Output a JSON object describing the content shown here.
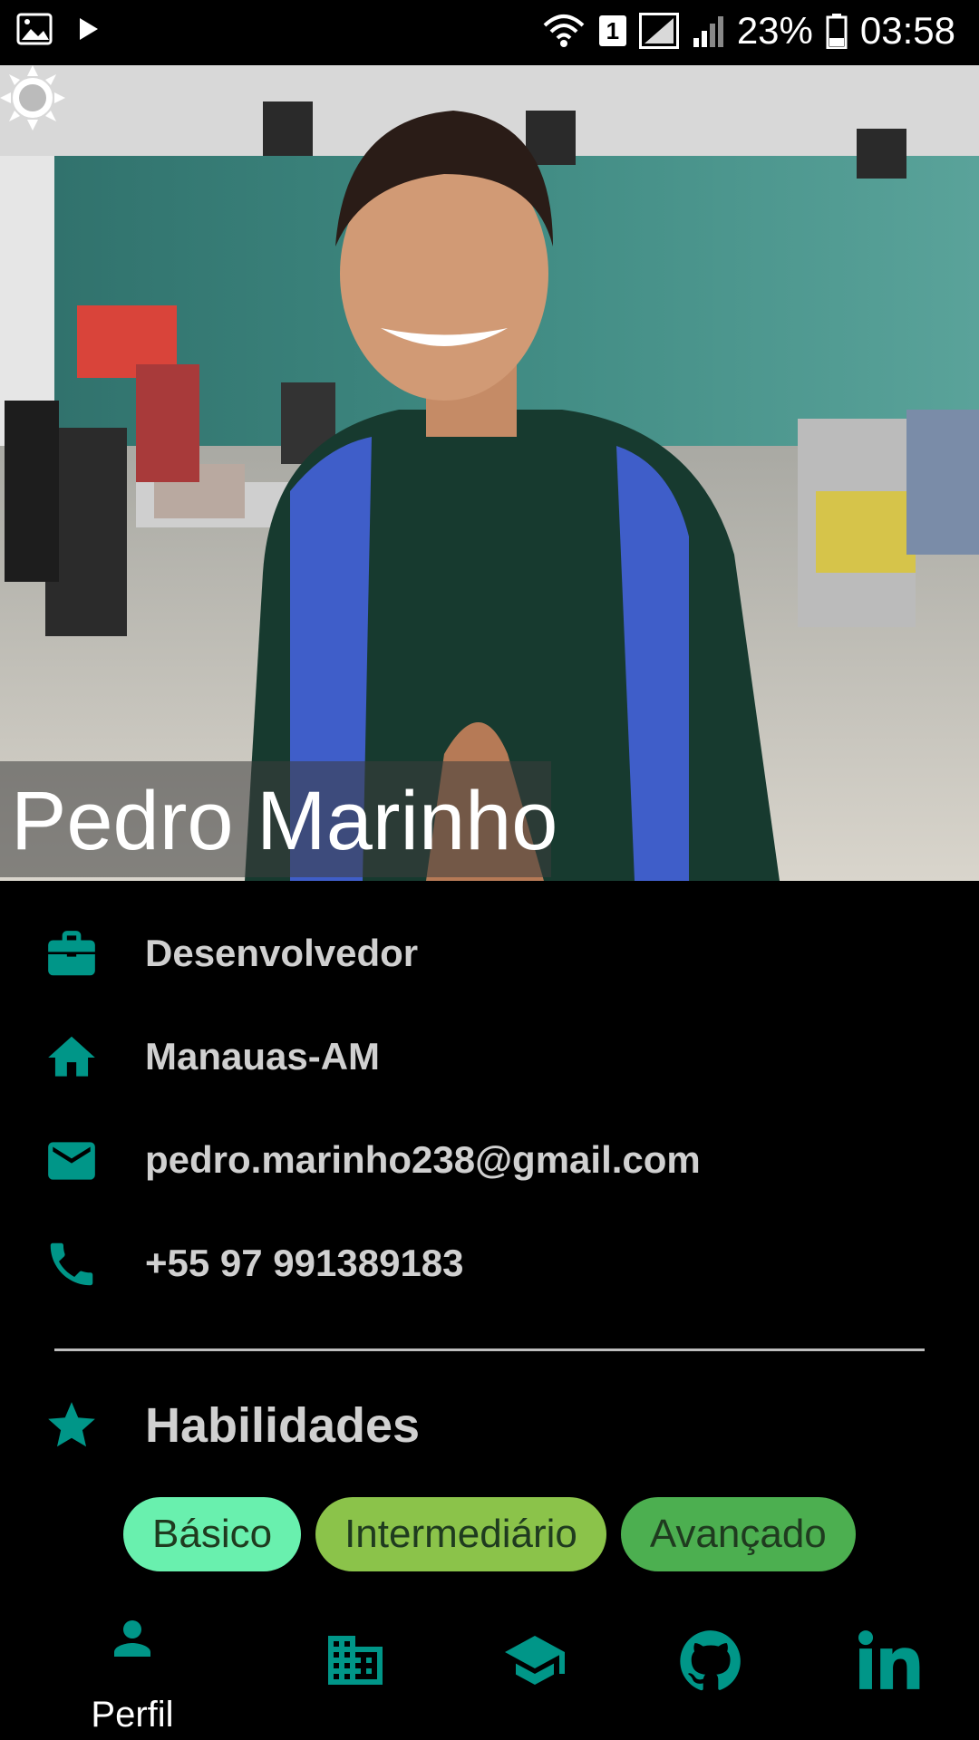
{
  "status_bar": {
    "battery": "23%",
    "time": "03:58",
    "sim_badge": "1"
  },
  "profile": {
    "name": "Pedro Marinho"
  },
  "info": [
    {
      "icon": "briefcase-icon",
      "label": "Desenvolvedor"
    },
    {
      "icon": "home-icon",
      "label": "Manauas-AM"
    },
    {
      "icon": "mail-icon",
      "label": "pedro.marinho238@gmail.com"
    },
    {
      "icon": "phone-icon",
      "label": "+55 97 991389183"
    }
  ],
  "skills": {
    "title": "Habilidades",
    "levels": [
      {
        "label": "Básico",
        "color": "#69f0ae"
      },
      {
        "label": "Intermediário",
        "color": "#8bc34a"
      },
      {
        "label": "Avançado",
        "color": "#4caf50"
      }
    ]
  },
  "bottom_nav": {
    "items": [
      {
        "icon": "person-icon",
        "label": "Perfil",
        "active": true
      },
      {
        "icon": "building-icon",
        "label": ""
      },
      {
        "icon": "graduation-cap-icon",
        "label": ""
      },
      {
        "icon": "github-icon",
        "label": ""
      },
      {
        "icon": "linkedin-icon",
        "label": ""
      }
    ]
  },
  "colors": {
    "accent": "#009688",
    "background": "#000000",
    "text": "#d0d0d0"
  }
}
